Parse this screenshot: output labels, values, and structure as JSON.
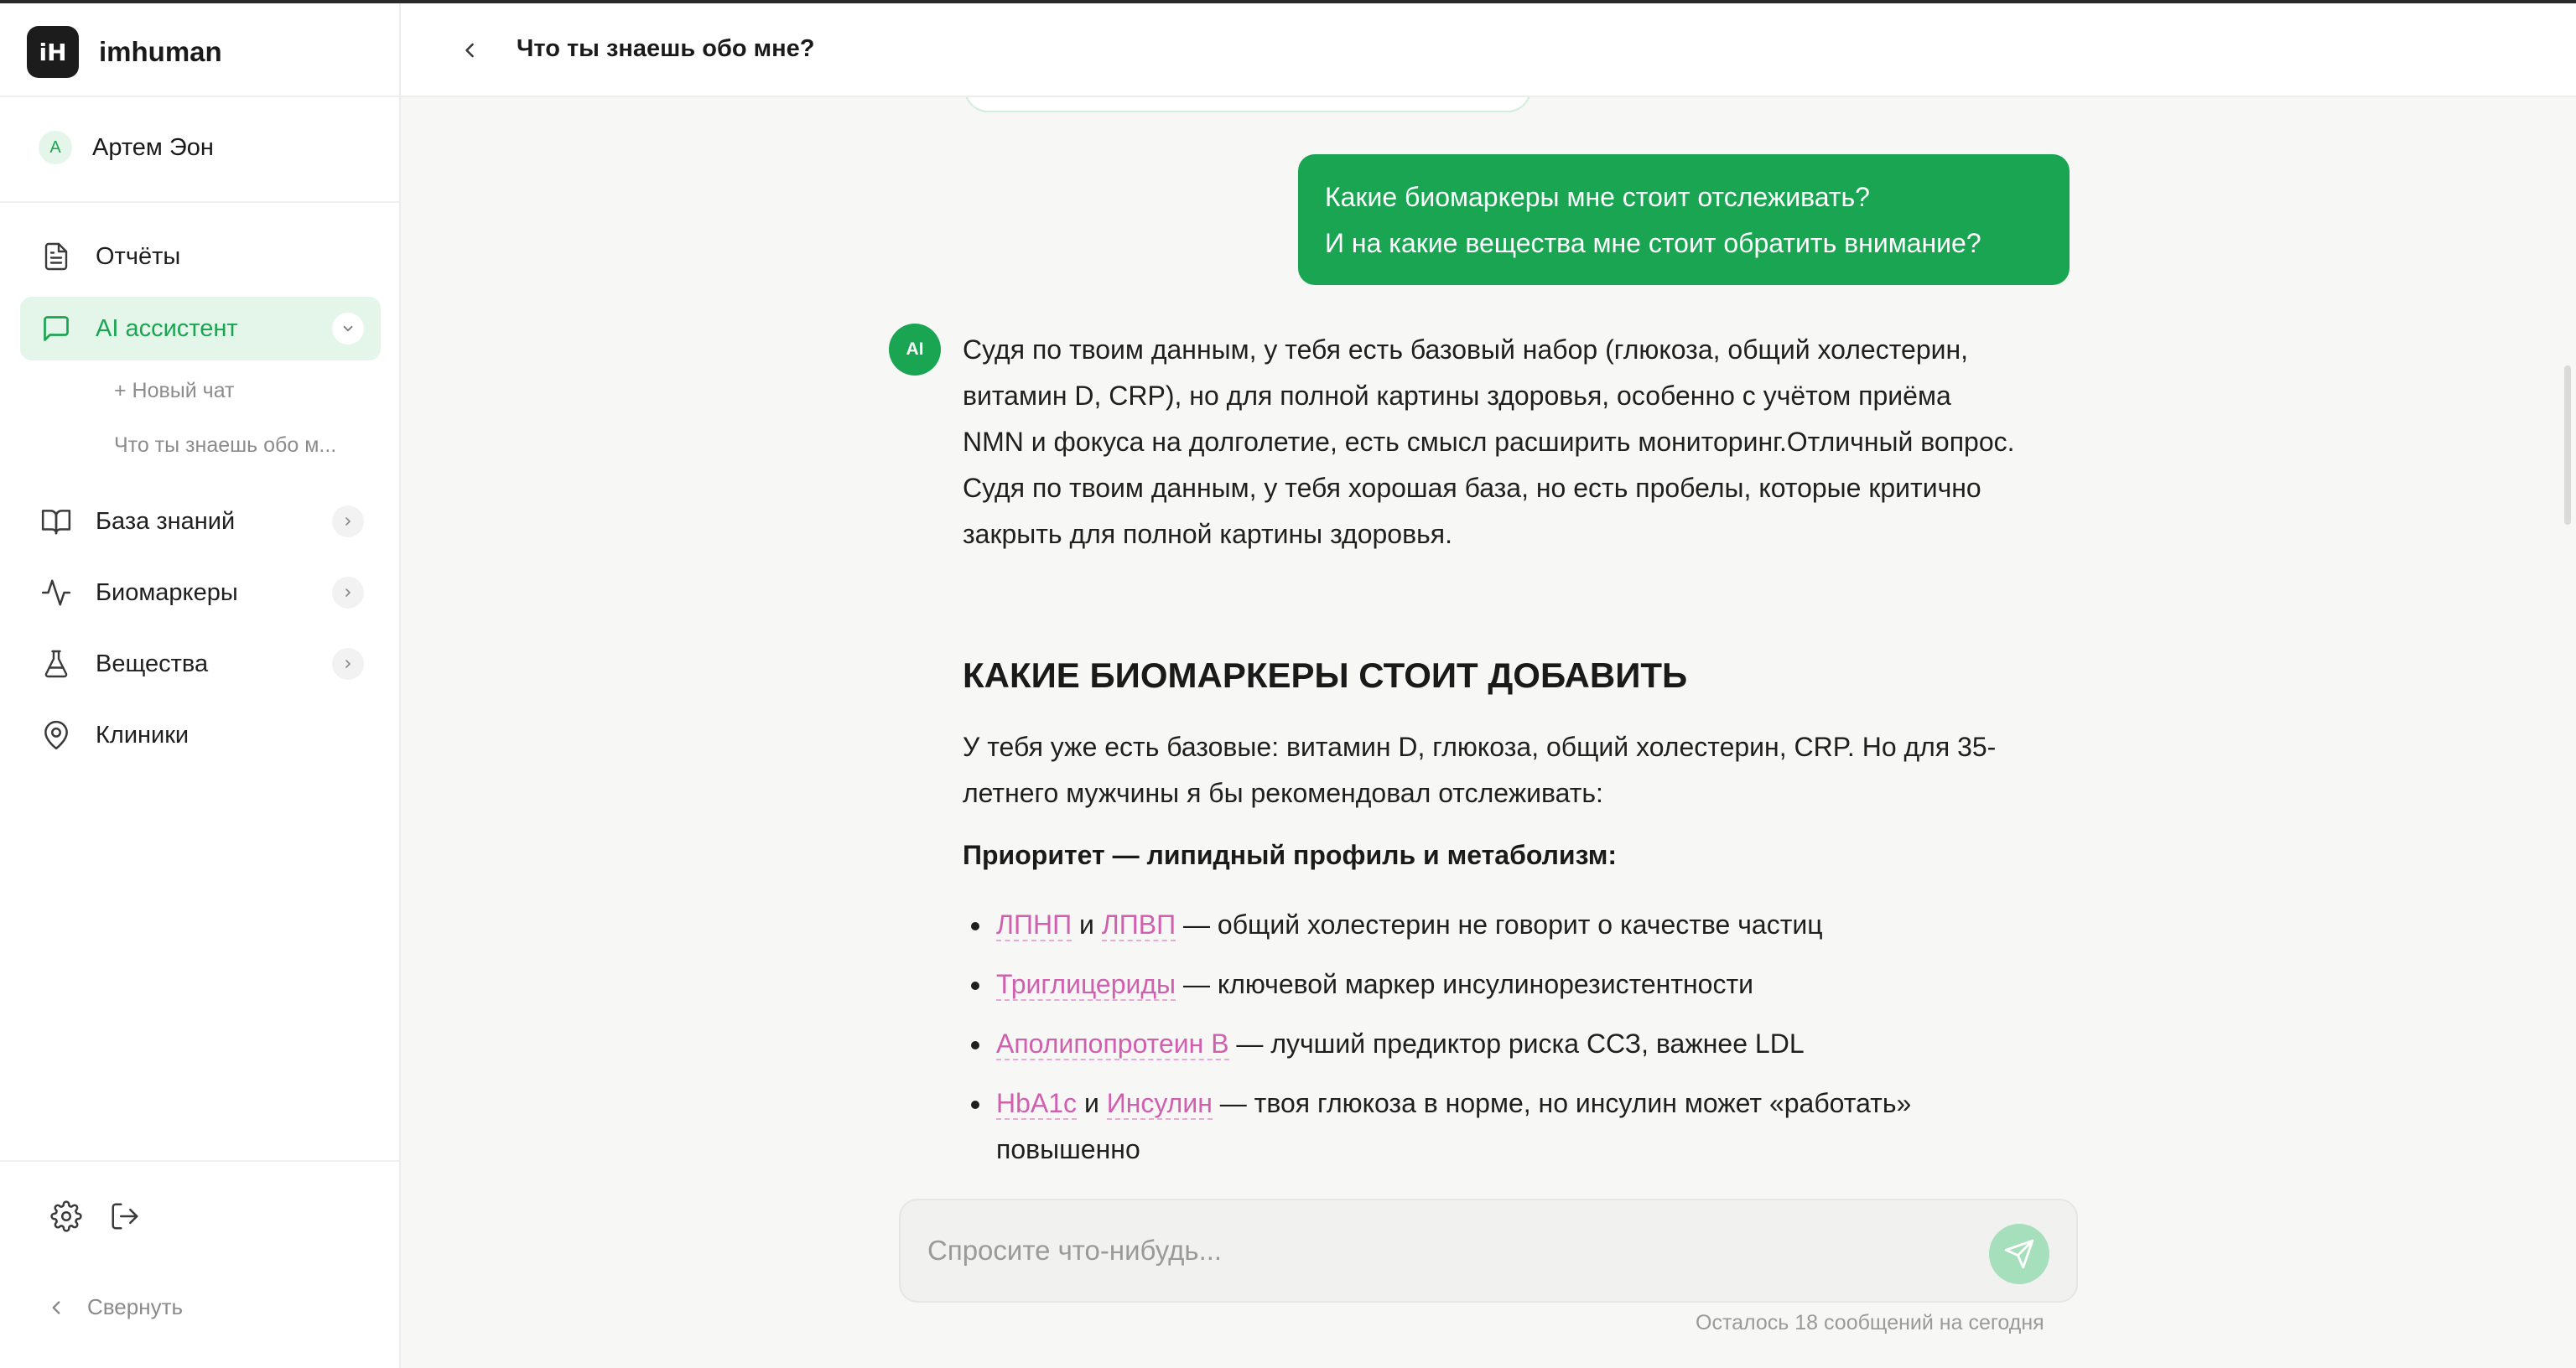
{
  "app": {
    "name": "imhuman",
    "logo_text": "iH"
  },
  "user": {
    "initial": "A",
    "name": "Артем Эон"
  },
  "sidebar": {
    "items": [
      {
        "label": "Отчёты",
        "icon": "document-icon"
      },
      {
        "label": "AI ассистент",
        "icon": "chat-icon",
        "active": true
      },
      {
        "label": "База знаний",
        "icon": "book-icon"
      },
      {
        "label": "Биомаркеры",
        "icon": "pulse-icon"
      },
      {
        "label": "Вещества",
        "icon": "flask-icon"
      },
      {
        "label": "Клиники",
        "icon": "map-pin-icon"
      }
    ],
    "sub_items": [
      "+ Новый чат",
      "Что ты знаешь обо м..."
    ],
    "collapse_label": "Свернуть"
  },
  "header": {
    "title": "Что ты знаешь обо мне?"
  },
  "chat": {
    "user_message": {
      "line1": "Какие биомаркеры мне стоит отслеживать?",
      "line2": "И на какие вещества мне стоит обратить внимание?"
    },
    "ai_avatar": "AI",
    "ai_intro": "Судя по твоим данным, у тебя есть базовый набор (глюкоза, общий холестерин, витамин D, CRP), но для полной картины здоровья, особенно с учётом приёма NMN и фокуса на долголетие, есть смысл расширить мониторинг.Отличный вопрос. Судя по твоим данным, у тебя хорошая база, но есть пробелы, которые критично закрыть для полной картины здоровья.",
    "heading": "КАКИЕ БИОМАРКЕРЫ СТОИТ ДОБАВИТЬ",
    "paragraph": "У тебя уже есть базовые: витамин D, глюкоза, общий холестерин, CRP. Но для 35-летнего мужчины я бы рекомендовал отслеживать:",
    "priority": "Приоритет — липидный профиль и метаболизм:",
    "bullets": [
      {
        "t1": "ЛПНП",
        "and": " и ",
        "t2": "ЛПВП",
        "rest": " — общий холестерин не говорит о качестве частиц"
      },
      {
        "t1": "Триглицериды",
        "rest": " — ключевой маркер инсулинорезистентности"
      },
      {
        "t1": "Аполипопротеин B",
        "rest": " — лучший предиктор риска ССЗ, важнее LDL"
      },
      {
        "t1": "HbA1c",
        "and": " и ",
        "t2": "Инсулин",
        "rest": " — твоя глюкоза в норме, но инсулин может «работать» повышенно"
      }
    ]
  },
  "composer": {
    "placeholder": "Спросите что-нибудь...",
    "limit_text": "Осталось 18 сообщений на сегодня"
  },
  "colors": {
    "accent": "#1aa552",
    "accent_light": "#e3f6e9",
    "term": "#d05fb0"
  }
}
